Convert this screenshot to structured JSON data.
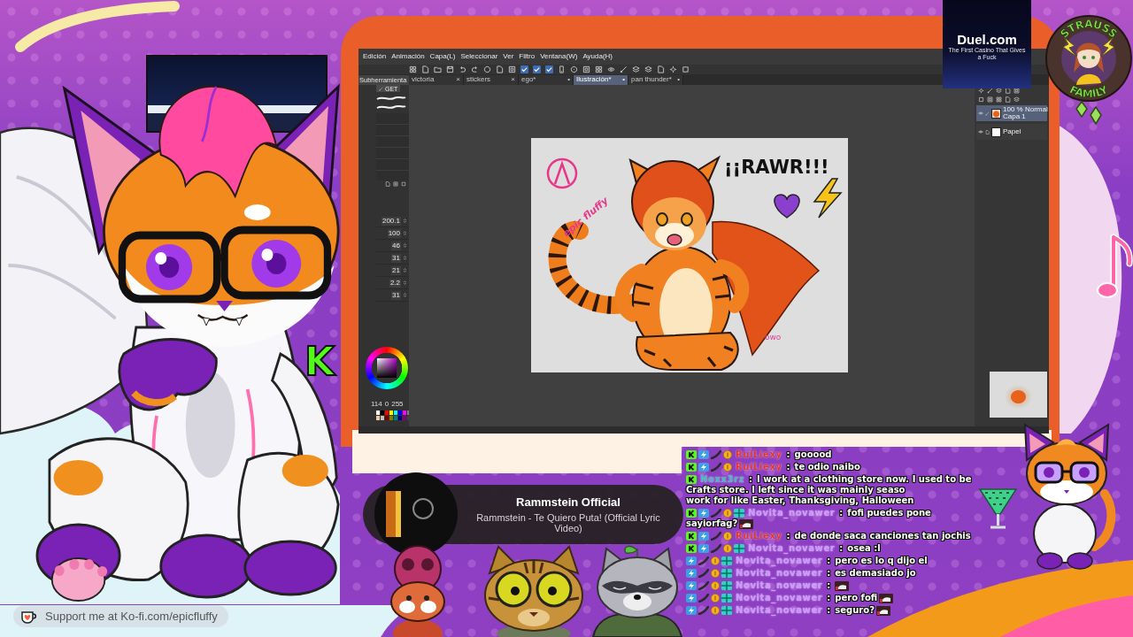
{
  "app": {
    "menu": [
      "Edición",
      "Animación",
      "Capa(L)",
      "Seleccionar",
      "Ver",
      "Filtro",
      "Ventana(W)",
      "Ayuda(H)"
    ],
    "tabs": [
      {
        "label": "victoria",
        "close": "×",
        "selected": false
      },
      {
        "label": "stickers",
        "close": "×",
        "selected": false
      },
      {
        "label": "ego*",
        "close": "•",
        "selected": false
      },
      {
        "label": "Ilustración*",
        "close": "•",
        "selected": true
      },
      {
        "label": "pan thunder*",
        "close": "•",
        "selected": false
      }
    ],
    "subtool_header": "Subherramienta",
    "brush_tab": "GET",
    "settings": [
      "200.1",
      "100",
      "46",
      "31",
      "21",
      "2.2",
      "31"
    ],
    "color_values": [
      "114",
      "0",
      "255"
    ],
    "palette": [
      {
        "color": "#ffffff"
      },
      {
        "color": "#000000"
      },
      {
        "color": "#ff0000"
      },
      {
        "color": "#ffff00"
      },
      {
        "color": "#00ffff"
      },
      {
        "color": "#0000ff"
      },
      {
        "color": "#ff00ff"
      },
      {
        "color": "#808080"
      },
      {
        "color": "#f8c8a0"
      },
      {
        "color": "#c0c0c0"
      },
      {
        "color": "#800000"
      },
      {
        "color": "#808000"
      },
      {
        "color": "#008080"
      },
      {
        "color": "#000080"
      },
      {
        "color": "#800080"
      },
      {
        "color": "#404040"
      }
    ],
    "layers": [
      {
        "mode": "100 % Normal",
        "name": "Capa 1",
        "kind": "raster",
        "selected": true
      },
      {
        "name": "Papel",
        "kind": "paper",
        "selected": false
      }
    ],
    "canvas": {
      "lettering": "¡¡RAWR!!!",
      "signature": "epic fluffy",
      "note": "owo"
    }
  },
  "kick_logo": "K",
  "now_playing": {
    "artist": "Rammstein Official",
    "title": "Rammstein - Te Quiero Puta! (Official Lyric Video)"
  },
  "chat": {
    "separator": ":",
    "messages": [
      {
        "badges": [
          {
            "kind": "k"
          },
          {
            "kind": "bolt"
          },
          {
            "kind": "blade"
          },
          {
            "kind": "coin"
          }
        ],
        "user": "RuiLiexy",
        "color": "#e2362c",
        "lines": [
          "gooood"
        ]
      },
      {
        "badges": [
          {
            "kind": "k"
          },
          {
            "kind": "bolt"
          },
          {
            "kind": "blade"
          },
          {
            "kind": "coin"
          }
        ],
        "user": "RuiLiexy",
        "color": "#e2362c",
        "lines": [
          "te odio naibo"
        ]
      },
      {
        "badges": [
          {
            "kind": "k"
          }
        ],
        "user": "Noxx3rz",
        "color": "#3dbdbf",
        "lines": [
          "I work at a clothing store now. I used to be",
          "Crafts store. I left since it was mainly seaso",
          "work for like Easter, Thanksgiving, Halloween"
        ]
      },
      {
        "badges": [
          {
            "kind": "k"
          },
          {
            "kind": "bolt"
          },
          {
            "kind": "blade"
          },
          {
            "kind": "coin"
          },
          {
            "kind": "gift"
          }
        ],
        "user": "Novita_novawer",
        "color": "#cc99ff",
        "lines": [
          "fofi puedes pone",
          "sayiorfag?"
        ],
        "emote": true
      },
      {
        "badges": [
          {
            "kind": "k"
          },
          {
            "kind": "bolt"
          },
          {
            "kind": "blade"
          },
          {
            "kind": "coin"
          }
        ],
        "user": "RuiLiexy",
        "color": "#e2362c",
        "lines": [
          "de donde saca canciones tan jochis"
        ]
      },
      {
        "badges": [
          {
            "kind": "k"
          },
          {
            "kind": "bolt"
          },
          {
            "kind": "blade"
          },
          {
            "kind": "coin"
          },
          {
            "kind": "gift"
          }
        ],
        "user": "Novita_novawer",
        "color": "#cc99ff",
        "lines": [
          "osea :l"
        ]
      },
      {
        "badges": [
          {
            "kind": "bolt"
          },
          {
            "kind": "blade"
          },
          {
            "kind": "coin"
          },
          {
            "kind": "gift"
          }
        ],
        "user": "Novita_novawer",
        "color": "#cc99ff",
        "lines": [
          "pero es lo q dijo el"
        ]
      },
      {
        "badges": [
          {
            "kind": "bolt"
          },
          {
            "kind": "blade"
          },
          {
            "kind": "coin"
          },
          {
            "kind": "gift"
          }
        ],
        "user": "Novita_novawer",
        "color": "#cc99ff",
        "lines": [
          "es demasiado jo"
        ]
      },
      {
        "badges": [
          {
            "kind": "bolt"
          },
          {
            "kind": "blade"
          },
          {
            "kind": "coin"
          },
          {
            "kind": "gift"
          }
        ],
        "user": "Novita_novawer",
        "color": "#cc99ff",
        "emote": true
      },
      {
        "badges": [
          {
            "kind": "bolt"
          },
          {
            "kind": "blade"
          },
          {
            "kind": "coin"
          },
          {
            "kind": "gift"
          }
        ],
        "user": "Novita_novawer",
        "color": "#cc99ff",
        "lines": [
          "pero fofi"
        ],
        "emote": true
      },
      {
        "badges": [
          {
            "kind": "bolt"
          },
          {
            "kind": "blade"
          },
          {
            "kind": "coin"
          },
          {
            "kind": "gift"
          }
        ],
        "user": "Novita_novawer",
        "color": "#cc99ff",
        "lines": [
          "seguro?"
        ],
        "emote": true
      }
    ]
  },
  "sponsor": {
    "brand": "Duel.com",
    "tagline": "The First Casino That Gives a Fuck"
  },
  "emblem": {
    "top": "STRAUSS",
    "bottom": "FAMILY"
  },
  "kofi": {
    "text": "Support me at Ko-fi.com/epicfluffy"
  }
}
